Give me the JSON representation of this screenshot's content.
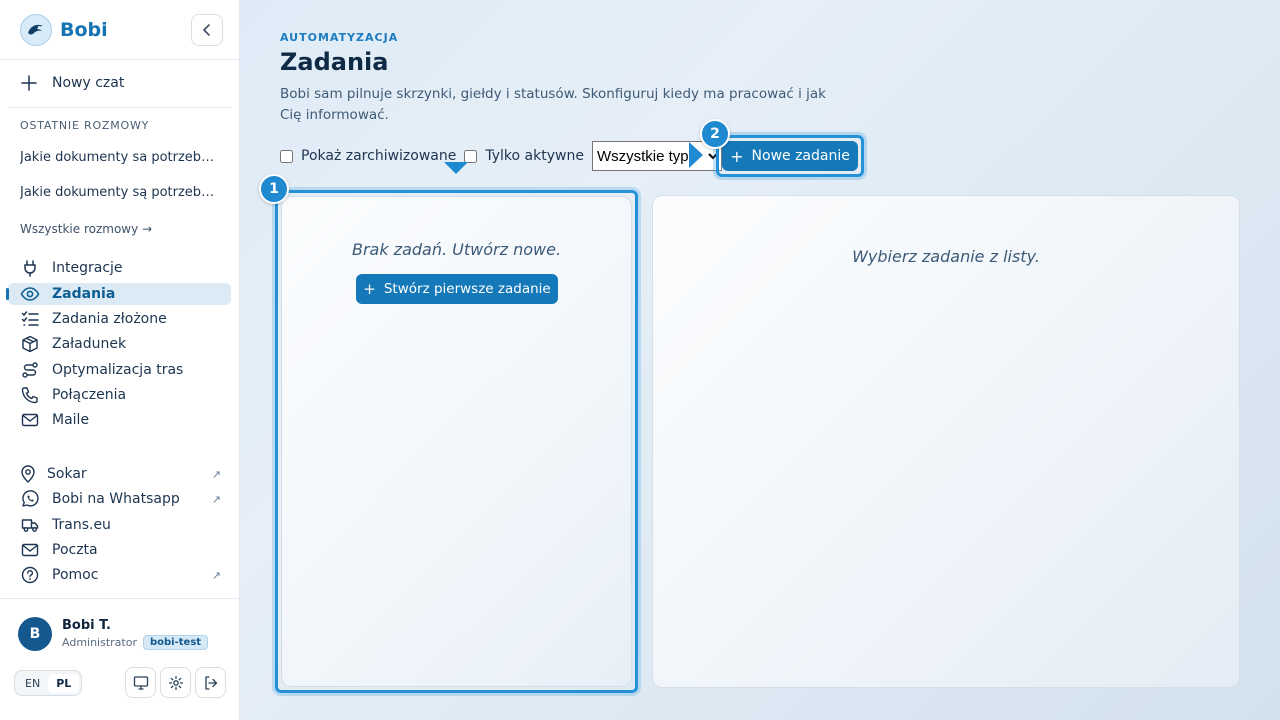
{
  "brand": {
    "name": "Bobi"
  },
  "sidebar": {
    "new_chat": "Nowy czat",
    "recent_title": "OSTATNIE ROZMOWY",
    "recent": [
      "Jakie dokumenty sa potrzebne do przewozu",
      "Jakie dokumenty są potrzebne do przewozu"
    ],
    "all_chats": "Wszystkie rozmowy →",
    "nav": [
      {
        "label": "Integracje",
        "icon": "plug-icon"
      },
      {
        "label": "Zadania",
        "icon": "eye-icon",
        "active": true
      },
      {
        "label": "Zadania złożone",
        "icon": "checklist-icon"
      },
      {
        "label": "Załadunek",
        "icon": "box-icon"
      },
      {
        "label": "Optymalizacja tras",
        "icon": "route-icon"
      },
      {
        "label": "Połączenia",
        "icon": "phone-icon"
      },
      {
        "label": "Maile",
        "icon": "mail-icon"
      }
    ],
    "external": [
      {
        "label": "Sokar",
        "icon": "map-pin-icon",
        "external": true
      },
      {
        "label": "Bobi na Whatsapp",
        "icon": "whatsapp-icon",
        "external": true
      },
      {
        "label": "Trans.eu",
        "icon": "truck-icon",
        "external": false
      },
      {
        "label": "Poczta",
        "icon": "mail-icon",
        "external": false
      },
      {
        "label": "Pomoc",
        "icon": "help-icon",
        "external": true
      }
    ],
    "external_arrow": "↗"
  },
  "user": {
    "initial": "B",
    "name": "Bobi T.",
    "role": "Administrator",
    "tenant": "bobi-test"
  },
  "lang": {
    "en": "EN",
    "pl": "PL",
    "selected": "PL"
  },
  "main": {
    "eyebrow": "AUTOMATYZACJA",
    "title": "Zadania",
    "description": "Bobi sam pilnuje skrzynki, giełdy i statusów. Skonfiguruj kiedy ma pracować i jak Cię informować.",
    "filters": {
      "show_archived": "Pokaż zarchiwizowane",
      "only_active": "Tylko aktywne",
      "type_selected": "Wszystkie typy"
    },
    "new_task": "Nowe zadanie",
    "empty_list": "Brak zadań. Utwórz nowe.",
    "create_first": "Stwórz pierwsze zadanie",
    "detail_empty": "Wybierz zadanie z listy."
  },
  "markers": {
    "one": "1",
    "two": "2"
  },
  "colors": {
    "accent": "#1478b9",
    "highlight": "#2491d9",
    "active_bg": "#dbeaf5"
  }
}
